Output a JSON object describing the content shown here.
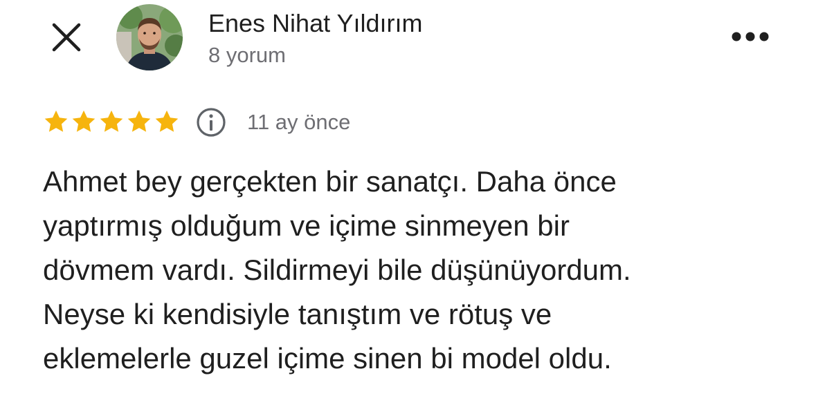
{
  "header": {
    "close_icon": "close-icon",
    "more_icon": "more-horizontal-icon",
    "avatar_icon": "user-avatar-photo"
  },
  "user": {
    "name": "Enes Nihat Yıldırım",
    "review_count": "8 yorum"
  },
  "review": {
    "rating": 5,
    "rating_max": 5,
    "star_color": "#f6b40e",
    "info_icon": "info-icon",
    "time_ago": "11 ay önce",
    "text_lines": [
      "Ahmet bey gerçekten bir sanatçı. Daha önce",
      "yaptırmış olduğum ve içime sinmeyen bir",
      "dövmem vardı. Sildirmeyi bile düşünüyordum.",
      "Neyse ki kendisiyle tanıştım ve rötuş ve",
      "eklemelerle guzel içime sinen bi model oldu."
    ]
  },
  "colors": {
    "text_primary": "#1f1f1f",
    "text_secondary": "#6e6e73",
    "star": "#f6b40e",
    "background": "#ffffff"
  }
}
